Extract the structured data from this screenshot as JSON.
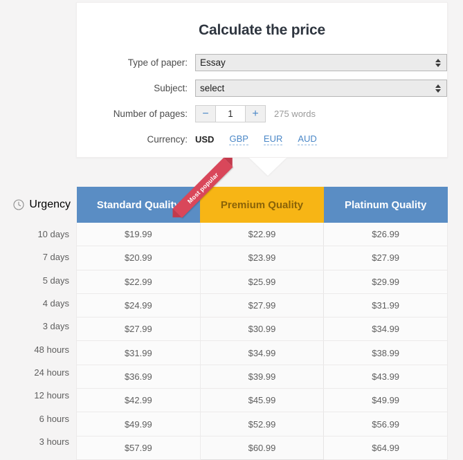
{
  "calculator": {
    "title": "Calculate the price",
    "fields": {
      "type_of_paper": {
        "label": "Type of paper:",
        "value": "Essay"
      },
      "subject": {
        "label": "Subject:",
        "value": "select"
      },
      "number_of_pages": {
        "label": "Number of pages:",
        "value": "1",
        "decrement_label": "−",
        "increment_label": "+",
        "words_note": "275 words"
      }
    },
    "currency": {
      "label": "Currency:",
      "options": [
        {
          "code": "USD",
          "active": true
        },
        {
          "code": "GBP",
          "active": false
        },
        {
          "code": "EUR",
          "active": false
        },
        {
          "code": "AUD",
          "active": false
        }
      ]
    }
  },
  "urgency": {
    "header_label": "Urgency",
    "icon": "clock-icon",
    "levels": [
      "10 days",
      "7 days",
      "5 days",
      "4 days",
      "3 days",
      "48 hours",
      "24 hours",
      "12 hours",
      "6 hours",
      "3 hours"
    ]
  },
  "price_table": {
    "ribbon_text": "Most popular",
    "columns": [
      {
        "label": "Standard Quality",
        "highlight": false
      },
      {
        "label": "Premium Quality",
        "highlight": true
      },
      {
        "label": "Platinum Quality",
        "highlight": false
      }
    ],
    "rows": [
      {
        "urgency": "10 days",
        "prices": [
          "$19.99",
          "$22.99",
          "$26.99"
        ]
      },
      {
        "urgency": "7 days",
        "prices": [
          "$20.99",
          "$23.99",
          "$27.99"
        ]
      },
      {
        "urgency": "5 days",
        "prices": [
          "$22.99",
          "$25.99",
          "$29.99"
        ]
      },
      {
        "urgency": "4 days",
        "prices": [
          "$24.99",
          "$27.99",
          "$31.99"
        ]
      },
      {
        "urgency": "3 days",
        "prices": [
          "$27.99",
          "$30.99",
          "$34.99"
        ]
      },
      {
        "urgency": "48 hours",
        "prices": [
          "$31.99",
          "$34.99",
          "$38.99"
        ]
      },
      {
        "urgency": "24 hours",
        "prices": [
          "$36.99",
          "$39.99",
          "$43.99"
        ]
      },
      {
        "urgency": "12 hours",
        "prices": [
          "$42.99",
          "$45.99",
          "$49.99"
        ]
      },
      {
        "urgency": "6 hours",
        "prices": [
          "$49.99",
          "$52.99",
          "$56.99"
        ]
      },
      {
        "urgency": "3 hours",
        "prices": [
          "$57.99",
          "$60.99",
          "$64.99"
        ]
      }
    ]
  },
  "colors": {
    "page_background": "#f5f4f4",
    "panel": "#ffffff",
    "header_blue": "#5a8dc4",
    "header_yellow": "#f7b515",
    "header_yellow_text": "#8a6308",
    "ribbon_red": "#d9475a",
    "link_blue": "#4a87c7",
    "text_gray": "#5e5e5e"
  }
}
